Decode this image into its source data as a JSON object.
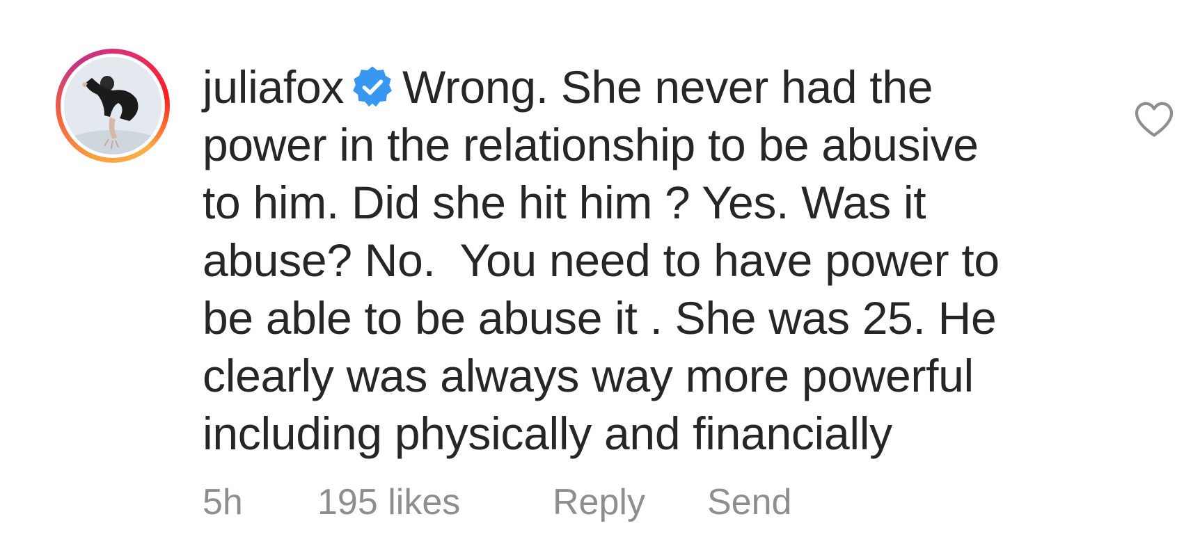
{
  "comment": {
    "username": "juliafox",
    "verified": true,
    "verified_icon": "verified-badge-icon",
    "verified_color": "#3897f0",
    "text_lines": [
      "Wrong. She never had the",
      "power in the relationship to be abusive",
      "to him. Did she hit him ? Yes. Was it",
      "abuse? No.  You need to have power to",
      "be able to be abuse it . She was 25. He",
      "clearly was always way more powerful",
      "including physically and financially"
    ],
    "time": "5h",
    "likes": "195 likes",
    "reply_label": "Reply",
    "send_label": "Send",
    "like_icon": "heart-outline-icon"
  },
  "colors": {
    "text": "#262626",
    "meta": "#8e8e8e",
    "heart": "#8e8e8e"
  }
}
